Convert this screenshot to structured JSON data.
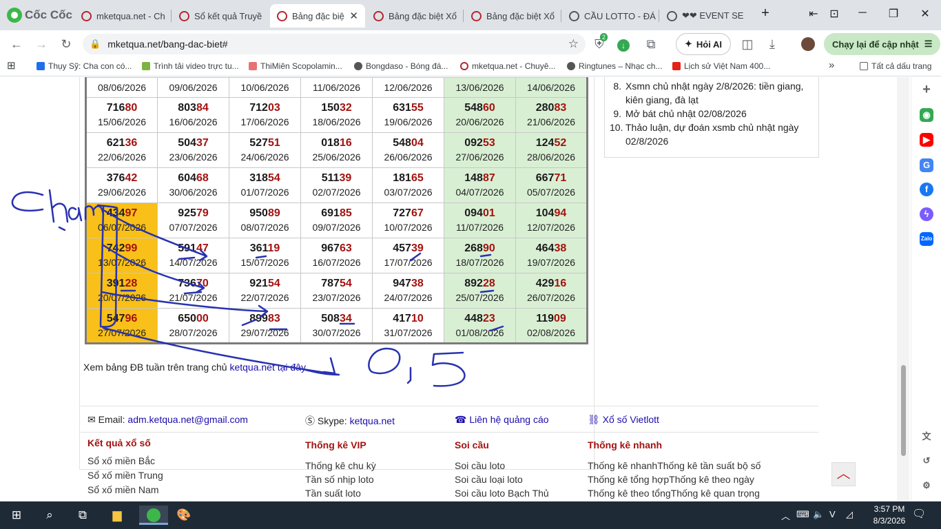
{
  "browser": {
    "brand": "Cốc Cốc",
    "tabs": [
      {
        "title": "mketqua.net - Ch",
        "active": false
      },
      {
        "title": "Sổ kết quả Truyề",
        "active": false
      },
      {
        "title": "Bảng đặc biệ",
        "active": true
      },
      {
        "title": "Bảng đặc biệt Xổ",
        "active": false
      },
      {
        "title": "Bảng đặc biệt Xổ",
        "active": false
      },
      {
        "title": "CẦU LOTTO - ĐÁ",
        "active": false
      },
      {
        "title": "❤❤ EVENT SE",
        "active": false
      }
    ],
    "url": "mketqua.net/bang-dac-biet#",
    "ask_ai": "Hỏi AI",
    "refresh_update": "Chạy lại để cập nhật",
    "extension_badge": "2",
    "bookmarks": [
      "Thụy Sỹ: Cha con có...",
      "Trình tải video trực tu...",
      "ThiMiên Scopolamin...",
      "Bongdaso - Bóng đá...",
      "mketqua.net - Chuyê...",
      "Ringtunes – Nhạc ch...",
      "Lịch sử Việt Nam 400..."
    ],
    "all_bookmarks": "Tất cả dấu trang"
  },
  "table": {
    "first_row_dates": [
      "08/06/2026",
      "09/06/2026",
      "10/06/2026",
      "11/06/2026",
      "12/06/2026",
      "13/06/2026",
      "14/06/2026"
    ],
    "rows": [
      [
        {
          "head": "716",
          "tail": "80",
          "date": "15/06/2026"
        },
        {
          "head": "803",
          "tail": "84",
          "date": "16/06/2026"
        },
        {
          "head": "712",
          "tail": "03",
          "date": "17/06/2026"
        },
        {
          "head": "150",
          "tail": "32",
          "date": "18/06/2026"
        },
        {
          "head": "631",
          "tail": "55",
          "date": "19/06/2026"
        },
        {
          "head": "548",
          "tail": "60",
          "date": "20/06/2026"
        },
        {
          "head": "280",
          "tail": "83",
          "date": "21/06/2026"
        }
      ],
      [
        {
          "head": "621",
          "tail": "36",
          "date": "22/06/2026"
        },
        {
          "head": "504",
          "tail": "37",
          "date": "23/06/2026"
        },
        {
          "head": "527",
          "tail": "51",
          "date": "24/06/2026"
        },
        {
          "head": "018",
          "tail": "16",
          "date": "25/06/2026"
        },
        {
          "head": "548",
          "tail": "04",
          "date": "26/06/2026"
        },
        {
          "head": "092",
          "tail": "53",
          "date": "27/06/2026"
        },
        {
          "head": "124",
          "tail": "52",
          "date": "28/06/2026"
        }
      ],
      [
        {
          "head": "376",
          "tail": "42",
          "date": "29/06/2026"
        },
        {
          "head": "604",
          "tail": "68",
          "date": "30/06/2026"
        },
        {
          "head": "318",
          "tail": "54",
          "date": "01/07/2026"
        },
        {
          "head": "511",
          "tail": "39",
          "date": "02/07/2026"
        },
        {
          "head": "181",
          "tail": "65",
          "date": "03/07/2026"
        },
        {
          "head": "148",
          "tail": "87",
          "date": "04/07/2026"
        },
        {
          "head": "667",
          "tail": "71",
          "date": "05/07/2026"
        }
      ],
      [
        {
          "head": "434",
          "tail": "97",
          "date": "06/07/2026"
        },
        {
          "head": "925",
          "tail": "79",
          "date": "07/07/2026"
        },
        {
          "head": "950",
          "tail": "89",
          "date": "08/07/2026"
        },
        {
          "head": "691",
          "tail": "85",
          "date": "09/07/2026"
        },
        {
          "head": "727",
          "tail": "67",
          "date": "10/07/2026"
        },
        {
          "head": "094",
          "tail": "01",
          "date": "11/07/2026"
        },
        {
          "head": "104",
          "tail": "94",
          "date": "12/07/2026"
        }
      ],
      [
        {
          "head": "742",
          "tail": "99",
          "date": "13/07/2026"
        },
        {
          "head": "591",
          "tail": "47",
          "date": "14/07/2026"
        },
        {
          "head": "361",
          "tail": "19",
          "date": "15/07/2026"
        },
        {
          "head": "967",
          "tail": "63",
          "date": "16/07/2026"
        },
        {
          "head": "457",
          "tail": "39",
          "date": "17/07/2026"
        },
        {
          "head": "268",
          "tail": "90",
          "date": "18/07/2026"
        },
        {
          "head": "464",
          "tail": "38",
          "date": "19/07/2026"
        }
      ],
      [
        {
          "head": "391",
          "tail": "28",
          "date": "20/07/2026"
        },
        {
          "head": "736",
          "tail": "70",
          "date": "21/07/2026"
        },
        {
          "head": "921",
          "tail": "54",
          "date": "22/07/2026"
        },
        {
          "head": "787",
          "tail": "54",
          "date": "23/07/2026"
        },
        {
          "head": "947",
          "tail": "38",
          "date": "24/07/2026"
        },
        {
          "head": "892",
          "tail": "28",
          "date": "25/07/2026"
        },
        {
          "head": "429",
          "tail": "16",
          "date": "26/07/2026"
        }
      ],
      [
        {
          "head": "547",
          "tail": "96",
          "date": "27/07/2026"
        },
        {
          "head": "650",
          "tail": "00",
          "date": "28/07/2026"
        },
        {
          "head": "899",
          "tail": "83",
          "date": "29/07/2026"
        },
        {
          "head": "508",
          "tail": "34",
          "date": "30/07/2026"
        },
        {
          "head": "417",
          "tail": "10",
          "date": "31/07/2026"
        },
        {
          "head": "448",
          "tail": "23",
          "date": "01/08/2026"
        },
        {
          "head": "119",
          "tail": "09",
          "date": "02/08/2026"
        }
      ]
    ]
  },
  "note": {
    "text": "Xem bảng ĐB tuần trên trang chủ",
    "link": "ketqua.net tại đây"
  },
  "side_list": [
    {
      "no": "8.",
      "text": "Xsmn chủ nhật ngày 2/8/2026: tiền giang, kiên giang, đà lạt"
    },
    {
      "no": "9.",
      "text": "Mở bát chủ nhật 02/08/2026"
    },
    {
      "no": "10.",
      "text": "Thảo luận, dự đoán xsmb chủ nhật ngày 02/8/2026"
    }
  ],
  "footer": {
    "email_label": "Email:",
    "email": "adm.ketqua.net@gmail.com",
    "skype_label": "Skype:",
    "skype": "ketqua.net",
    "ads": "Liên hệ quảng cáo",
    "vietlott": "Xổ số Vietlott",
    "columns": [
      {
        "title": "Kết quả xổ số",
        "links": [
          "Sổ xố miền Bắc",
          "Sổ xố miền Trung",
          "Sổ xố miền Nam"
        ]
      },
      {
        "title": "Thống kê VIP",
        "links": [
          "Thống kê chu kỳ",
          "Tần số nhịp loto",
          "Tần suất loto"
        ]
      },
      {
        "title": "Soi cầu",
        "links": [
          "Soi cầu loto",
          "Soi cầu loại loto",
          "Soi cầu loto Bạch Thủ"
        ]
      },
      {
        "title": "Thống kê nhanh",
        "links": [
          "Thống kê nhanhThống kê tần suất bộ số",
          "Thống kê tổng hợpThống kê theo ngày",
          "Thống kê theo tổngThống kê quan trọng"
        ]
      }
    ]
  },
  "taskbar": {
    "time": "3:57 PM",
    "date": "8/3/2026"
  },
  "colors": {
    "highlight": "#f8c018",
    "weekend": "#d9efd4",
    "tail": "#a3120f",
    "annotation": "#2832b0"
  },
  "annotations": {
    "word": "Chạm",
    "number": "0,5"
  }
}
